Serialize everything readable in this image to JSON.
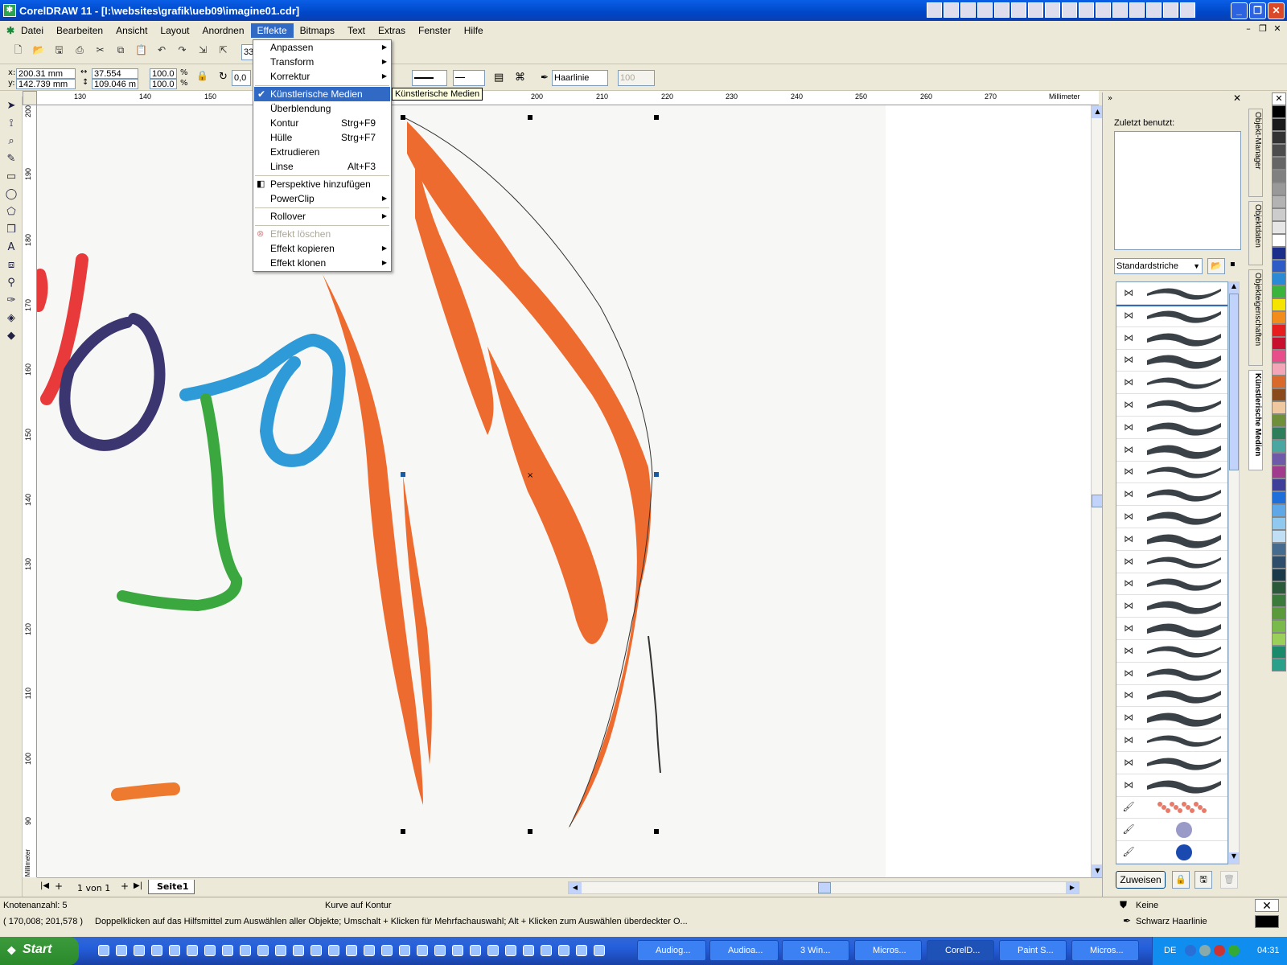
{
  "window": {
    "title": "CorelDRAW 11 - [I:\\websites\\grafik\\ueb09\\imagine01.cdr]",
    "minimize": "_",
    "maximize": "❐",
    "close": "✕"
  },
  "menubar": {
    "items": [
      "Datei",
      "Bearbeiten",
      "Ansicht",
      "Layout",
      "Anordnen",
      "Effekte",
      "Bitmaps",
      "Text",
      "Extras",
      "Fenster",
      "Hilfe"
    ],
    "active": "Effekte"
  },
  "propertybar": {
    "x_label": "x:",
    "x_value": "200.31 mm",
    "y_label": "y:",
    "y_value": "142.739 mm",
    "w_value": "37.554 mm",
    "h_value": "109.046 m",
    "scale_x": "100.0",
    "scale_y": "100.0",
    "percent": "%",
    "angle": "0,0",
    "zoom_partial": "33",
    "outline_width": "Haarlinie",
    "smoothing": "100"
  },
  "effects_menu": {
    "items": [
      {
        "label": "Anpassen",
        "shortcut": "",
        "submenu": true
      },
      {
        "label": "Transform",
        "shortcut": "",
        "submenu": true
      },
      {
        "label": "Korrektur",
        "shortcut": "",
        "submenu": true
      },
      {
        "label": "Künstlerische Medien",
        "shortcut": "",
        "submenu": false
      },
      {
        "label": "Überblendung",
        "shortcut": "",
        "submenu": false
      },
      {
        "label": "Kontur",
        "shortcut": "Strg+F9",
        "submenu": false
      },
      {
        "label": "Hülle",
        "shortcut": "Strg+F7",
        "submenu": false
      },
      {
        "label": "Extrudieren",
        "shortcut": "",
        "submenu": false
      },
      {
        "label": "Linse",
        "shortcut": "Alt+F3",
        "submenu": false
      },
      {
        "label": "Perspektive hinzufügen",
        "shortcut": "",
        "submenu": false
      },
      {
        "label": "PowerClip",
        "shortcut": "",
        "submenu": true
      },
      {
        "label": "Rollover",
        "shortcut": "",
        "submenu": true
      },
      {
        "label": "Effekt löschen",
        "shortcut": "",
        "submenu": false
      },
      {
        "label": "Effekt kopieren",
        "shortcut": "",
        "submenu": true
      },
      {
        "label": "Effekt klonen",
        "shortcut": "",
        "submenu": true
      }
    ],
    "highlighted": "Künstlerische Medien",
    "disabled": "Effekt löschen",
    "tooltip": "Künstlerische Medien"
  },
  "ruler": {
    "unit": "Millimeter",
    "h_ticks": [
      "130",
      "140",
      "150",
      "200",
      "210",
      "220",
      "230",
      "240",
      "250",
      "260",
      "270"
    ],
    "v_ticks": [
      "200",
      "190",
      "180",
      "170",
      "160",
      "150",
      "140",
      "130",
      "120",
      "110",
      "100",
      "90"
    ]
  },
  "page_nav": {
    "counter": "1 von 1",
    "page_tab": "Seite1"
  },
  "docker": {
    "recent_label": "Zuletzt benutzt:",
    "dropdown": "Standardstriche",
    "apply_button": "Zuweisen",
    "tabs": [
      "Objekt-Manager",
      "Objektdaten",
      "Objekteigenschaften",
      "Künstlerische Medien"
    ]
  },
  "palette": [
    "#000000",
    "#1a1a1a",
    "#333333",
    "#4d4d4d",
    "#666666",
    "#808080",
    "#999999",
    "#b3b3b3",
    "#cccccc",
    "#e6e6e6",
    "#ffffff",
    "#1c2e8c",
    "#2d5cc7",
    "#2a8ad6",
    "#3bb43b",
    "#f5e400",
    "#f28c1a",
    "#e61e1e",
    "#c8102e",
    "#e84f8a",
    "#f2a6b7",
    "#d96a2b",
    "#8a4a1c",
    "#f0c8a0",
    "#6f8f3b",
    "#2e7d5b",
    "#4aa6a0",
    "#6e5aa8",
    "#a13b8e",
    "#3f3f9a",
    "#1e6fd9",
    "#5fa8e8",
    "#8fc9f0",
    "#c0dff5",
    "#456b8e",
    "#2d4d6b",
    "#1a3a4a",
    "#2a5a3a",
    "#3a7a3a",
    "#5a9a3a",
    "#7aba4a",
    "#9ad05a",
    "#1a8a6a",
    "#2aa08a"
  ],
  "status": {
    "nodes": "Knotenanzahl: 5",
    "object_info": "Kurve auf Kontur",
    "coords": "( 170,008; 201,578 )",
    "hint": "Doppelklicken auf das Hilfsmittel zum Auswählen aller Objekte; Umschalt + Klicken für Mehrfachauswahl; Alt + Klicken zum Auswählen überdeckter O...",
    "fill": "Keine",
    "outline": "Schwarz  Haarlinie"
  },
  "taskbar": {
    "start": "Start",
    "tasks": [
      "Audiog...",
      "Audioa...",
      "3 Win...",
      "Micros...",
      "CorelD...",
      "Paint S...",
      "Micros..."
    ],
    "active_task": "CorelD...",
    "language": "DE",
    "clock": "04:31"
  },
  "colors": {
    "orange": "#EE6B2F",
    "blue": "#2E9AD8",
    "green": "#3BA83F",
    "indigo": "#3C3670",
    "red": "#E83A3A",
    "menu_highlight": "#316AC5"
  }
}
